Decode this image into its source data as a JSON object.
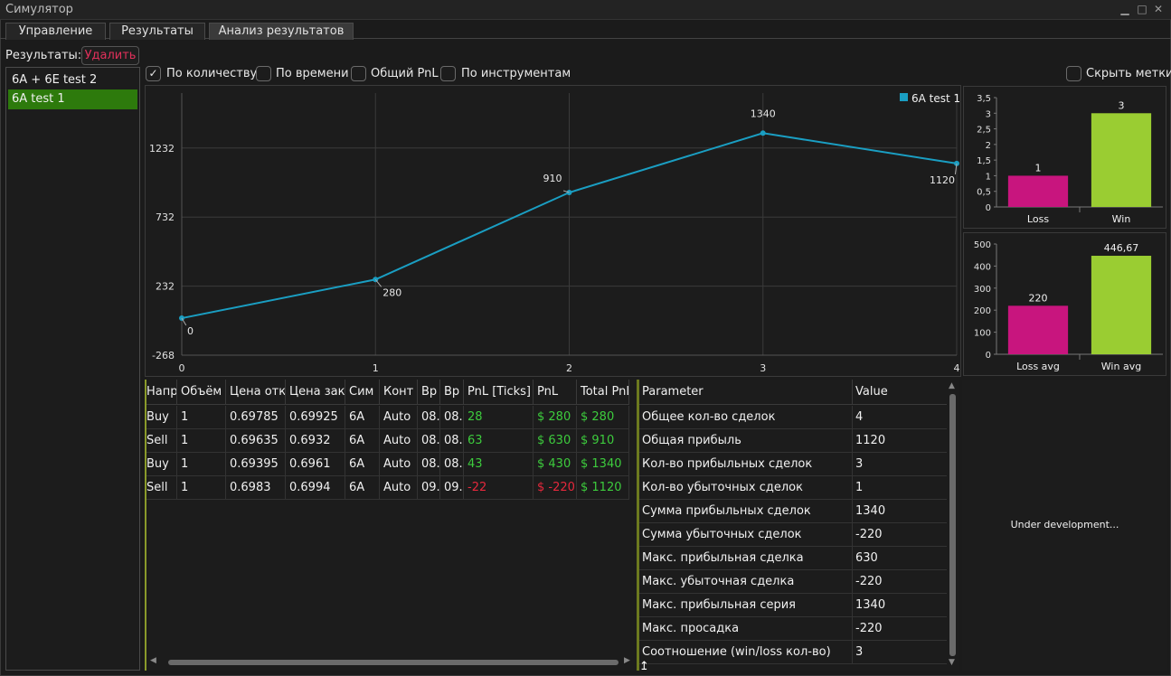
{
  "window": {
    "title": "Симулятор",
    "min_icon": "minimize-icon",
    "max_icon": "maximize-icon",
    "close_icon": "close-icon"
  },
  "tabs": [
    {
      "label": "Управление",
      "active": false
    },
    {
      "label": "Результаты",
      "active": false
    },
    {
      "label": "Анализ результатов",
      "active": true
    }
  ],
  "results": {
    "label": "Результаты:",
    "delete_label": "Удалить",
    "items": [
      "6A + 6E test 2",
      "6A test 1"
    ],
    "selected_index": 1
  },
  "filters": [
    {
      "label": "По количеству",
      "checked": true
    },
    {
      "label": "По времени",
      "checked": false
    },
    {
      "label": "Общий PnL",
      "checked": false
    },
    {
      "label": "По инструментам",
      "checked": false
    }
  ],
  "hide_labels": {
    "label": "Скрыть метки",
    "checked": false
  },
  "colors": {
    "line": "#1a9ec2",
    "loss": "#c8157e",
    "win": "#9acd32",
    "selected": "#2d7a0c",
    "green": "#3dcc3d",
    "red": "#e6283c"
  },
  "chart_data": [
    {
      "type": "line",
      "x": [
        0,
        1,
        2,
        3,
        4
      ],
      "xticks": [
        "0",
        "1",
        "2",
        "3",
        "4"
      ],
      "series": [
        {
          "name": "6A test 1",
          "values": [
            0,
            280,
            910,
            1340,
            1120
          ]
        }
      ],
      "point_labels": [
        "0",
        "280",
        "910",
        "1340",
        "1120"
      ],
      "yticks": [
        "-268",
        "232",
        "732",
        "1232"
      ],
      "ylim": [
        -268,
        1630
      ],
      "xlim": [
        0,
        4
      ],
      "grid": true,
      "legend": "top-right"
    },
    {
      "type": "bar",
      "categories": [
        "Loss",
        "Win"
      ],
      "values": [
        1,
        3
      ],
      "value_labels": [
        "1",
        "3"
      ],
      "yticks": [
        "0",
        "0,5",
        "1",
        "1,5",
        "2",
        "2,5",
        "3",
        "3,5"
      ],
      "ylim": [
        0,
        3.5
      ]
    },
    {
      "type": "bar",
      "categories": [
        "Loss avg",
        "Win avg"
      ],
      "values": [
        220,
        446.67
      ],
      "value_labels": [
        "220",
        "446,67"
      ],
      "yticks": [
        "0",
        "100",
        "200",
        "300",
        "400",
        "500"
      ],
      "ylim": [
        0,
        500
      ]
    }
  ],
  "trades": {
    "headers": [
      "Напр",
      "Объём",
      "Цена отк",
      "Цена зак",
      "Сим",
      "Конт",
      "Вр",
      "Вр",
      "PnL [Ticks]",
      "PnL",
      "Total PnL"
    ],
    "rows": [
      [
        "Buy",
        "1",
        "0.69785",
        "0.69925",
        "6A",
        "Auto",
        "08.",
        "08.",
        "28",
        "$ 280",
        "$ 280"
      ],
      [
        "Sell",
        "1",
        "0.69635",
        "0.6932",
        "6A",
        "Auto",
        "08.",
        "08.",
        "63",
        "$ 630",
        "$ 910"
      ],
      [
        "Buy",
        "1",
        "0.69395",
        "0.6961",
        "6A",
        "Auto",
        "08.",
        "08.",
        "43",
        "$ 430",
        "$ 1340"
      ],
      [
        "Sell",
        "1",
        "0.6983",
        "0.6994",
        "6A",
        "Auto",
        "09.",
        "09.",
        "-22",
        "$ -220",
        "$ 1120"
      ]
    ],
    "pnl_sign": [
      "pos",
      "pos",
      "pos",
      "neg"
    ]
  },
  "params": {
    "headers": [
      "Parameter",
      "Value"
    ],
    "rows": [
      [
        "Общее кол-во сделок",
        "4"
      ],
      [
        "Общая прибыль",
        "1120"
      ],
      [
        "Кол-во прибыльных сделок",
        "3"
      ],
      [
        "Кол-во убыточных сделок",
        "1"
      ],
      [
        "Сумма прибыльных сделок",
        "1340"
      ],
      [
        "Сумма убыточных сделок",
        "-220"
      ],
      [
        "Макс. прибыльная сделка",
        "630"
      ],
      [
        "Макс. убыточная сделка",
        "-220"
      ],
      [
        "Макс. прибыльная серия",
        "1340"
      ],
      [
        "Макс. просадка",
        "-220"
      ],
      [
        "Соотношение (win/loss кол-во)",
        "3"
      ]
    ]
  },
  "under_development": "Under development..."
}
